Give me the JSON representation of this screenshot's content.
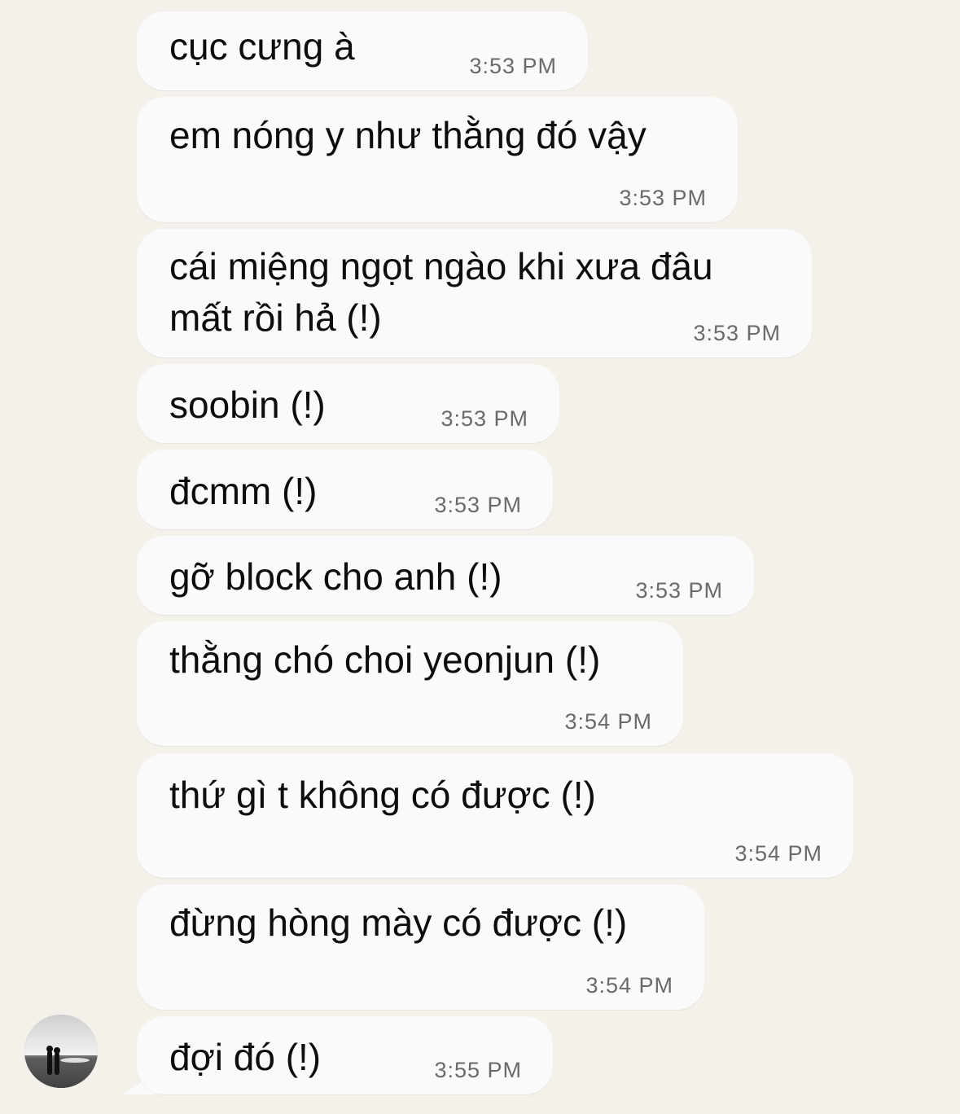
{
  "messages": [
    {
      "text": "cục cưng à",
      "time": "3:53 PM"
    },
    {
      "text": "em nóng y như thằng đó vậy",
      "time": "3:53 PM"
    },
    {
      "text_line1": "cái miệng ngọt ngào khi xưa đâu",
      "text_line2": "mất rồi hả (!)",
      "time": "3:53 PM"
    },
    {
      "text": "soobin (!)",
      "time": "3:53 PM"
    },
    {
      "text": "đcmm (!)",
      "time": "3:53 PM"
    },
    {
      "text": "gỡ block cho anh (!)",
      "time": "3:53 PM"
    },
    {
      "text": "thằng chó choi yeonjun (!)",
      "time": "3:54 PM"
    },
    {
      "text": "thứ gì t không có được (!)",
      "time": "3:54 PM"
    },
    {
      "text": "đừng hòng mày có được (!)",
      "time": "3:54 PM"
    },
    {
      "text": "đợi đó (!)",
      "time": "3:55 PM"
    }
  ],
  "icons": {
    "avatar": "contact-avatar-photo"
  }
}
